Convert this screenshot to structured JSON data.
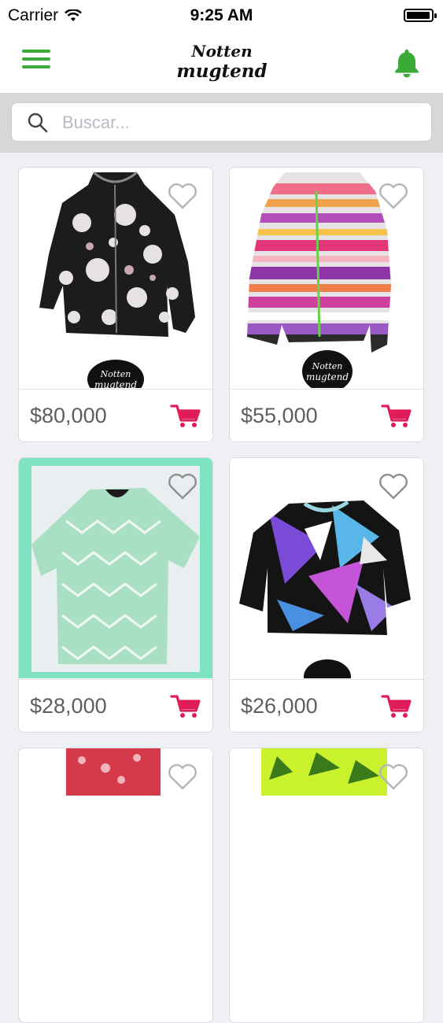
{
  "status_bar": {
    "carrier": "Carrier",
    "time": "9:25 AM",
    "battery_level": 0.95
  },
  "header": {
    "logo_line1": "Notten",
    "logo_line2": "mugtend",
    "menu_icon": "hamburger-menu-icon",
    "bell_icon": "bell-icon",
    "accent_color": "#3bab38"
  },
  "search": {
    "placeholder": "Buscar...",
    "value": ""
  },
  "products": [
    {
      "price": "$80,000",
      "badge_line1": "Notten",
      "badge_line2": "mugtend"
    },
    {
      "price": "$55,000",
      "badge_line1": "Notten",
      "badge_line2": "mugtend"
    },
    {
      "price": "$28,000"
    },
    {
      "price": "$26,000"
    }
  ],
  "cart_color": "#e01d5a"
}
